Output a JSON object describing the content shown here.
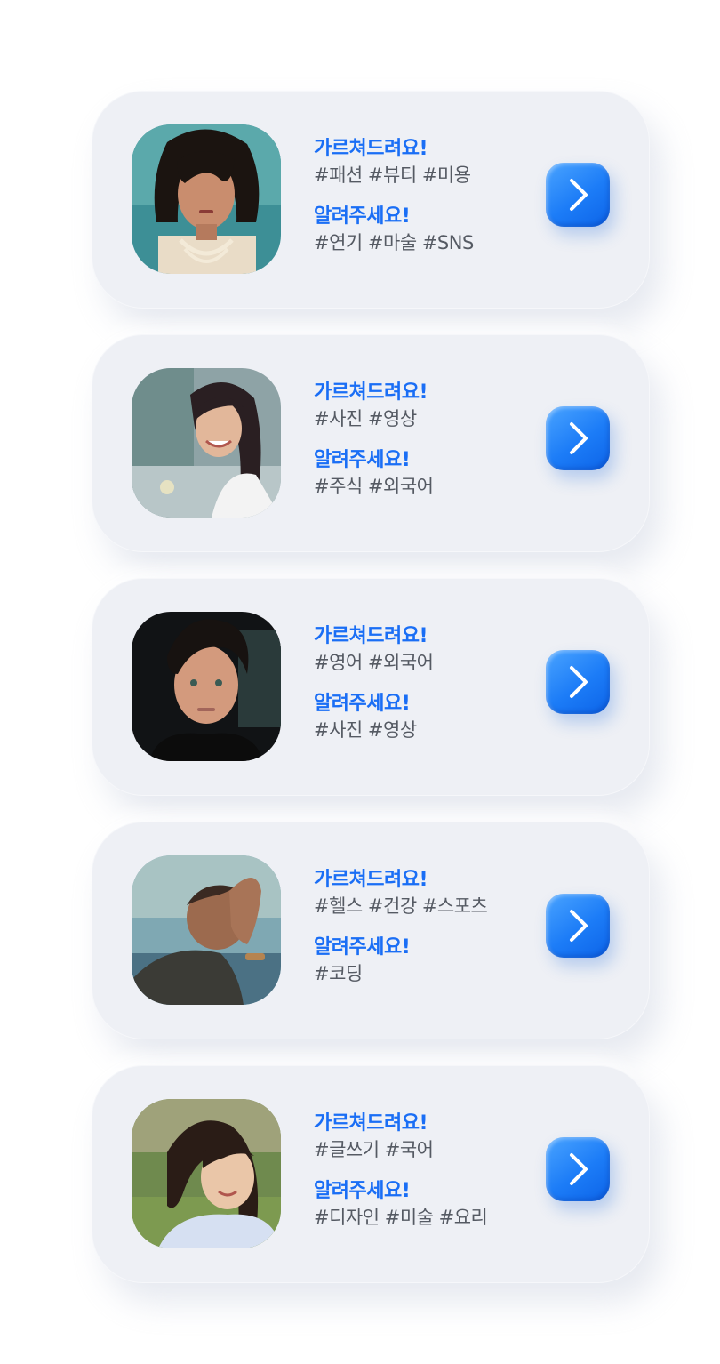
{
  "cards": [
    {
      "teach_label": "가르쳐드려요!",
      "teach_tags": "#패션 #뷰티 #미용",
      "learn_label": "알려주세요!",
      "learn_tags": "#연기 #마술 #SNS",
      "action_icon": "chevron-right-icon"
    },
    {
      "teach_label": "가르쳐드려요!",
      "teach_tags": "#사진 #영상",
      "learn_label": "알려주세요!",
      "learn_tags": "#주식 #외국어",
      "action_icon": "chevron-right-icon"
    },
    {
      "teach_label": "가르쳐드려요!",
      "teach_tags": "#영어 #외국어",
      "learn_label": "알려주세요!",
      "learn_tags": "#사진 #영상",
      "action_icon": "chevron-right-icon"
    },
    {
      "teach_label": "가르쳐드려요!",
      "teach_tags": "#헬스 #건강 #스포츠",
      "learn_label": "알려주세요!",
      "learn_tags": "#코딩",
      "action_icon": "chevron-right-icon"
    },
    {
      "teach_label": "가르쳐드려요!",
      "teach_tags": "#글쓰기 #국어",
      "learn_label": "알려주세요!",
      "learn_tags": "#디자인 #미술 #요리",
      "action_icon": "chevron-right-icon"
    }
  ],
  "colors": {
    "accent": "#1a6ef5",
    "card_bg": "#eef0f5",
    "tag_text": "#555a63",
    "button_gradient_top": "#4aa4ff",
    "button_gradient_bottom": "#0d64e8"
  }
}
